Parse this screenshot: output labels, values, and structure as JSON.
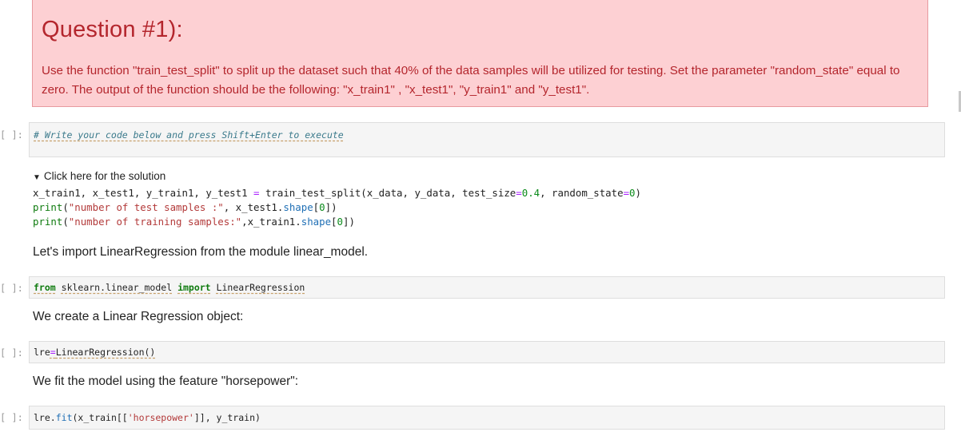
{
  "question": {
    "title": "Question #1):",
    "body": "Use the function \"train_test_split\" to split up the dataset such that 40% of the data samples will be utilized for testing. Set the parameter \"random_state\" equal to zero. The output of the function should be the following: \"x_train1\" , \"x_test1\", \"y_train1\" and \"y_test1\"."
  },
  "prompt_label": "[ ]:",
  "cells": {
    "c1": {
      "comment": "# Write your code below and press Shift+Enter to execute"
    },
    "c2": {
      "kw_from": "from",
      "module": "sklearn.linear_model",
      "kw_import": "import",
      "name": "LinearRegression"
    },
    "c3": {
      "var": "lre",
      "op": "=",
      "call": "LinearRegression()"
    },
    "c4": {
      "obj": "lre",
      "dot": ".",
      "method": "fit",
      "p1": "(x_train[[",
      "s": "'horsepower'",
      "p2": "]], y_train)"
    }
  },
  "solution": {
    "summary": "Click here for the solution",
    "line1": {
      "lhs": "x_train1, x_test1, y_train1, y_test1 ",
      "eq": "=",
      "rhs_a": " train_test_split(x_data, y_data, test_size",
      "eq2": "=",
      "num1": "0.4",
      "rhs_b": ", random_state",
      "eq3": "=",
      "num2": "0",
      "rhs_c": ")"
    },
    "line2": {
      "fn": "print",
      "open": "(",
      "str": "\"number of test samples :\"",
      "mid": ", x_test1.",
      "attr": "shape",
      "idx_open": "[",
      "num": "0",
      "close": "])"
    },
    "line3": {
      "fn": "print",
      "open": "(",
      "str": "\"number of training samples:\"",
      "mid": ",x_train1.",
      "attr": "shape",
      "idx_open": "[",
      "num": "0",
      "close": "])"
    }
  },
  "markdown": {
    "m1": "Let's import LinearRegression from the module linear_model.",
    "m2": "We create a Linear Regression object:",
    "m3": "We fit the model using the feature \"horsepower\":"
  }
}
